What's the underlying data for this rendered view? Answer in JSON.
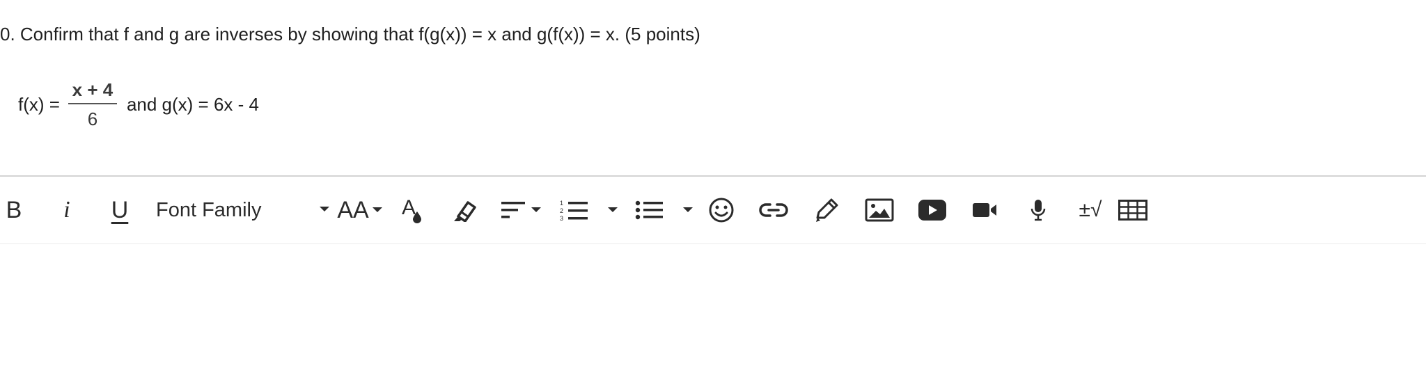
{
  "question": {
    "text": "0. Confirm that f and g are inverses by showing that f(g(x)) = x and g(f(x)) = x. (5 points)"
  },
  "formula": {
    "f_label": "f(x) =",
    "numerator": "x + 4",
    "denominator": "6",
    "rest": "and g(x) = 6x - 4"
  },
  "toolbar": {
    "bold": "B",
    "italic": "i",
    "underline": "U",
    "font_family": "Font Family",
    "font_size": "AA",
    "math_label": "±√",
    "icons": [
      "bold-icon",
      "italic-icon",
      "underline-icon",
      "font-size-icon",
      "text-color-icon",
      "highlight-icon",
      "align-icon",
      "numbered-list-icon",
      "bulleted-list-icon",
      "emoji-icon",
      "link-icon",
      "draw-icon",
      "image-icon",
      "youtube-icon",
      "video-icon",
      "microphone-icon",
      "math-icon",
      "table-icon"
    ]
  }
}
